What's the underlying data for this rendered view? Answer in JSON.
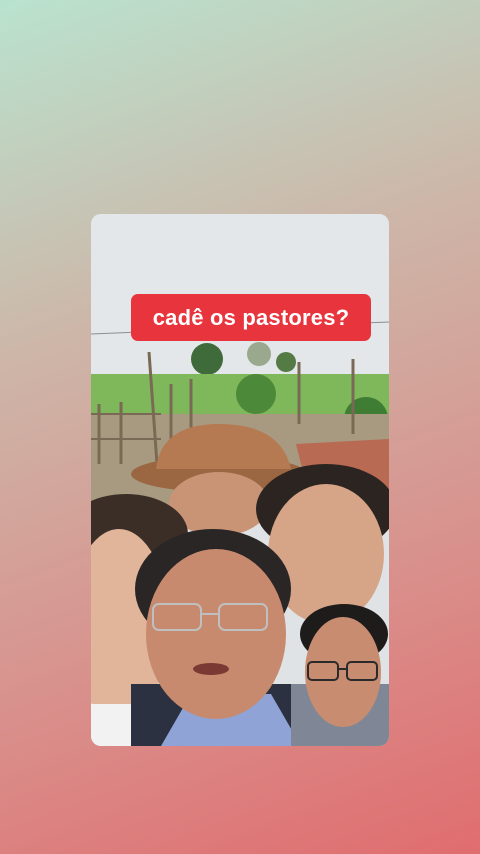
{
  "post": {
    "caption": "cadê os pastores?"
  },
  "colors": {
    "caption_bg": "#e8343d",
    "caption_text": "#ffffff",
    "bg_top": "#b9e3cf",
    "bg_bottom": "#e06d6f"
  }
}
